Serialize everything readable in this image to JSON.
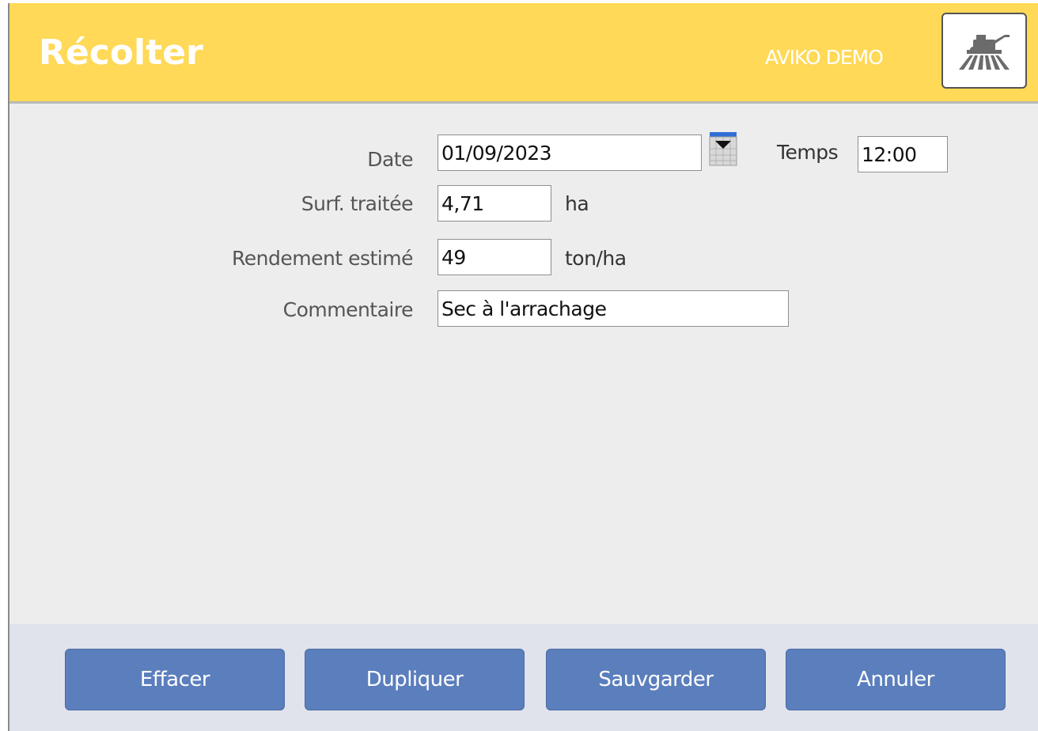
{
  "header": {
    "title": "Récolter",
    "organization": "AVIKO DEMO",
    "tool_icon": "harvester-icon",
    "background_color": "#ffd957"
  },
  "form": {
    "date": {
      "label": "Date",
      "value": "01/09/2023",
      "calendar_icon": "calendar-icon"
    },
    "time": {
      "label": "Temps",
      "value": "12:00"
    },
    "area": {
      "label": "Surf. traitée",
      "value": "4,71",
      "unit": "ha"
    },
    "yield": {
      "label": "Rendement estimé",
      "value": "49",
      "unit": "ton/ha"
    },
    "comment": {
      "label": "Commentaire",
      "value": "Sec à l'arrachage"
    }
  },
  "footer": {
    "buttons": {
      "clear": "Effacer",
      "duplicate": "Dupliquer",
      "save": "Sauvgarder",
      "cancel": "Annuler"
    },
    "button_color": "#5b7ebd"
  }
}
